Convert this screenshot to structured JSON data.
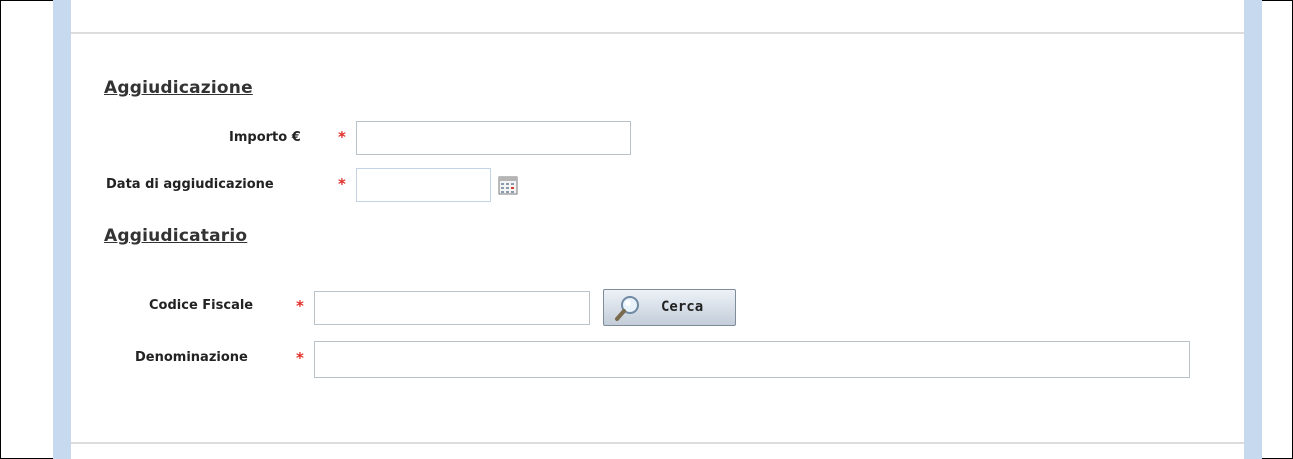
{
  "aggiudicazione": {
    "title": "Aggiudicazione",
    "importo_label": "Importo €",
    "importo_value": "",
    "data_label": "Data di aggiudicazione",
    "data_value": ""
  },
  "aggiudicatario": {
    "title": "Aggiudicatario",
    "codice_fiscale_label": "Codice Fiscale",
    "codice_fiscale_value": "",
    "cerca_label": "Cerca",
    "denominazione_label": "Denominazione",
    "denominazione_value": ""
  },
  "required_mark": "*",
  "colors": {
    "required": "#e0302a",
    "side_band": "#c6d9ee"
  },
  "icons": {
    "calendar": "calendar-icon",
    "search": "magnifier-icon"
  }
}
